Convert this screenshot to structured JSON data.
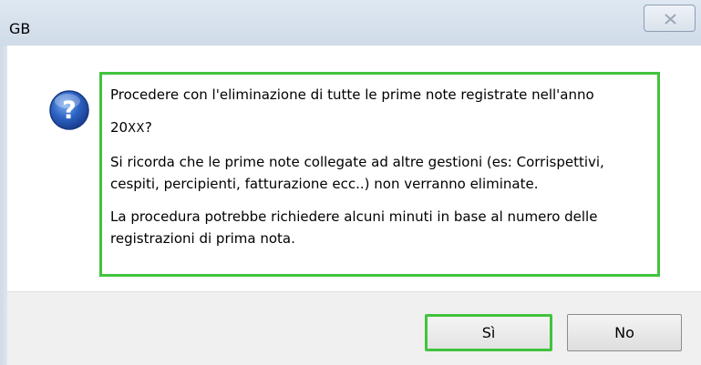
{
  "window": {
    "title": "GB",
    "close_symbol": "✕"
  },
  "message": {
    "icon": "question-icon",
    "line1": "Procedere con l'eliminazione di tutte le prime note registrate nell'anno",
    "year_prefix": "20",
    "year_suffix": "XX",
    "year_end": "?",
    "paragraph2": "Si ricorda che le prime note collegate ad altre gestioni (es: Corrispettivi,\ncespiti, percipienti, fatturazione ecc..) non verranno eliminate.",
    "paragraph3": "La procedura potrebbe richiedere alcuni minuti in base al numero delle\nregistrazioni di prima nota."
  },
  "buttons": {
    "yes_label": "Sì",
    "no_label": "No"
  },
  "colors": {
    "highlight": "#41c33e",
    "icon_blue": "#2a5fbf"
  }
}
